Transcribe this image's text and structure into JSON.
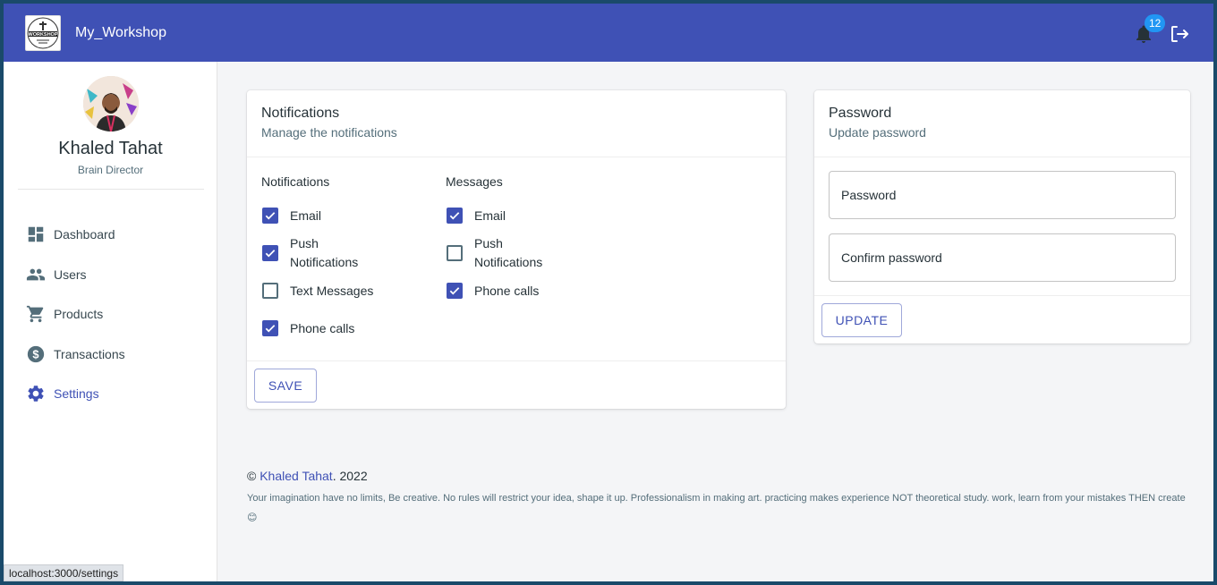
{
  "app": {
    "title": "My_Workshop",
    "logo_text": "WORKSHOP"
  },
  "header": {
    "notifications_count": "12"
  },
  "user": {
    "name": "Khaled Tahat",
    "role": "Brain Director"
  },
  "nav": {
    "items": [
      {
        "label": "Dashboard",
        "icon": "dashboard-icon"
      },
      {
        "label": "Users",
        "icon": "people-icon"
      },
      {
        "label": "Products",
        "icon": "cart-icon"
      },
      {
        "label": "Transactions",
        "icon": "dollar-icon"
      },
      {
        "label": "Settings",
        "icon": "gear-icon",
        "active": true
      }
    ]
  },
  "notifications_card": {
    "title": "Notifications",
    "subtitle": "Manage the notifications",
    "groups": [
      {
        "title": "Notifications",
        "options": [
          {
            "label": "Email",
            "checked": true
          },
          {
            "label": "Push Notifications",
            "checked": true
          },
          {
            "label": "Text Messages",
            "checked": false
          },
          {
            "label": "Phone calls",
            "checked": true
          }
        ]
      },
      {
        "title": "Messages",
        "options": [
          {
            "label": "Email",
            "checked": true
          },
          {
            "label": "Push Notifications",
            "checked": false
          },
          {
            "label": "Phone calls",
            "checked": true
          }
        ]
      }
    ],
    "save_label": "SAVE"
  },
  "password_card": {
    "title": "Password",
    "subtitle": "Update password",
    "password_placeholder": "Password",
    "confirm_placeholder": "Confirm password",
    "update_label": "UPDATE"
  },
  "footer": {
    "copyright_symbol": "©",
    "author": "Khaled Tahat",
    "year_text": ". 2022",
    "text": "Your imagination have no limits, Be creative. No rules will restrict your idea, shape it up. Professionalism in making art. practicing makes experience NOT theoretical study. work, learn from your mistakes THEN create 😊"
  },
  "status_bar": {
    "url": "localhost:3000/settings"
  },
  "colors": {
    "primary": "#3f51b5",
    "badge": "#2196f3",
    "background": "#f4f5f7"
  }
}
